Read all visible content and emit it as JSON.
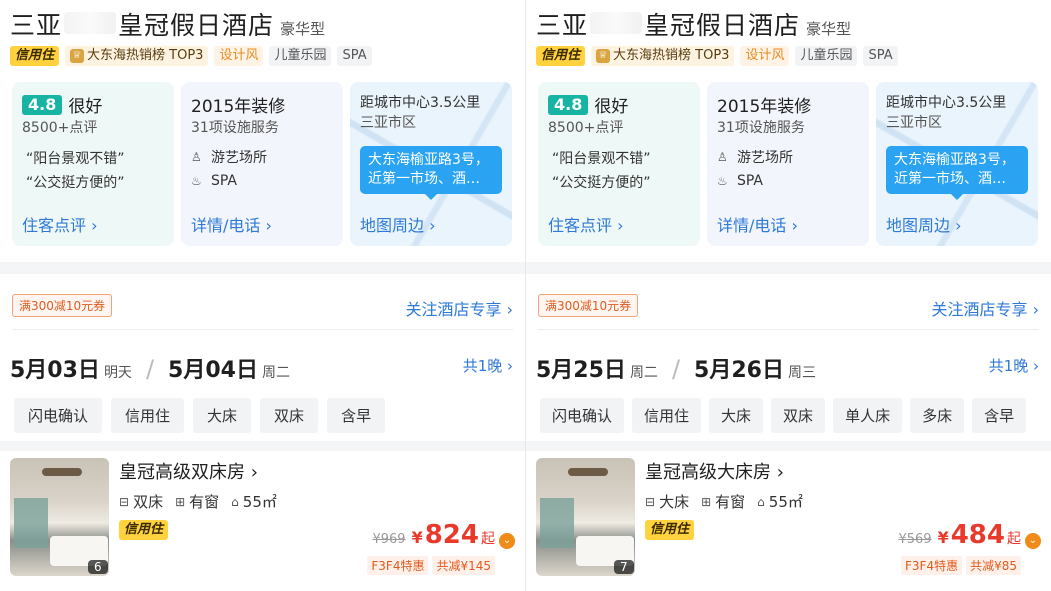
{
  "panels": [
    {
      "hotel_name_prefix": "三亚",
      "hotel_name_suffix": "皇冠假日酒店",
      "hotel_type": "豪华型",
      "tags": {
        "credit": "信用住",
        "rank": "大东海热销榜 TOP3",
        "style": "设计风",
        "kids": "儿童乐园",
        "spa": "SPA"
      },
      "rating": {
        "score": "4.8",
        "word": "很好",
        "count": "8500+点评",
        "quote1": "“阳台景观不错”",
        "quote2": "“公交挺方便的”",
        "link": "住客点评 ›"
      },
      "info": {
        "renovation": "2015年装修",
        "services": "31项设施服务",
        "facility1": "游艺场所",
        "facility2": "SPA",
        "link": "详情/电话 ›"
      },
      "map": {
        "distance": "距城市中心3.5公里",
        "district": "三亚市区",
        "address": "大东海榆亚路3号，近第一市场、酒…",
        "link": "地图周边 ›"
      },
      "coupon": "满300减10元券",
      "follow": "关注酒店专享 ›",
      "checkin": "5月03日",
      "checkin_week": "明天",
      "checkout": "5月04日",
      "checkout_week": "周二",
      "nights": "共1晚 ›",
      "filters": [
        "闪电确认",
        "信用住",
        "大床",
        "双床",
        "含早"
      ],
      "room": {
        "name": "皇冠高级双床房 ›",
        "bed": "双床",
        "window": "有窗",
        "area": "55㎡",
        "credit": "信用住",
        "photo_count": "6",
        "old_price": "¥969",
        "yen": "¥",
        "price": "824",
        "qi": "起",
        "disc1": "F3F4特惠",
        "disc2": "共减¥145"
      }
    },
    {
      "hotel_name_prefix": "三亚",
      "hotel_name_suffix": "皇冠假日酒店",
      "hotel_type": "豪华型",
      "tags": {
        "credit": "信用住",
        "rank": "大东海热销榜 TOP3",
        "style": "设计风",
        "kids": "儿童乐园",
        "spa": "SPA"
      },
      "rating": {
        "score": "4.8",
        "word": "很好",
        "count": "8500+点评",
        "quote1": "“阳台景观不错”",
        "quote2": "“公交挺方便的”",
        "link": "住客点评 ›"
      },
      "info": {
        "renovation": "2015年装修",
        "services": "31项设施服务",
        "facility1": "游艺场所",
        "facility2": "SPA",
        "link": "详情/电话 ›"
      },
      "map": {
        "distance": "距城市中心3.5公里",
        "district": "三亚市区",
        "address": "大东海榆亚路3号，近第一市场、酒…",
        "link": "地图周边 ›"
      },
      "coupon": "满300减10元券",
      "follow": "关注酒店专享 ›",
      "checkin": "5月25日",
      "checkin_week": "周二",
      "checkout": "5月26日",
      "checkout_week": "周三",
      "nights": "共1晚 ›",
      "filters": [
        "闪电确认",
        "信用住",
        "大床",
        "双床",
        "单人床",
        "多床",
        "含早"
      ],
      "room": {
        "name": "皇冠高级大床房 ›",
        "bed": "大床",
        "window": "有窗",
        "area": "55㎡",
        "credit": "信用住",
        "photo_count": "7",
        "old_price": "¥569",
        "yen": "¥",
        "price": "484",
        "qi": "起",
        "disc1": "F3F4特惠",
        "disc2": "共减¥85"
      }
    }
  ]
}
